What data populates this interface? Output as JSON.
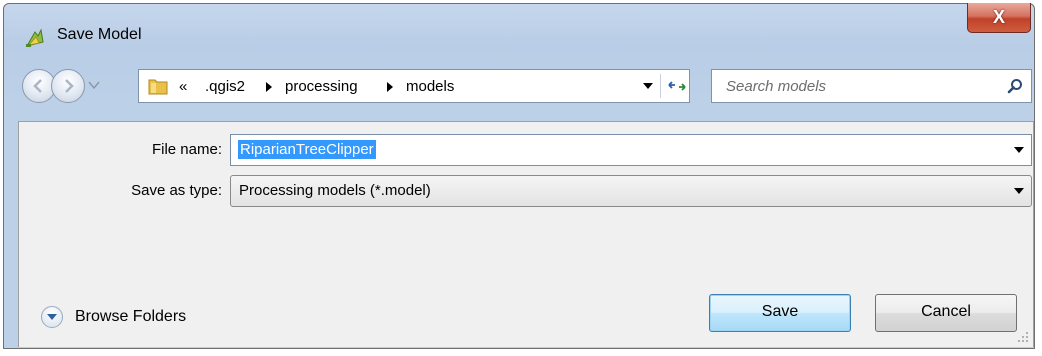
{
  "window": {
    "title": "Save Model",
    "close_label": "X"
  },
  "nav": {
    "breadcrumb_overflow": "«",
    "breadcrumbs": [
      ".qgis2",
      "processing",
      "models"
    ],
    "search_placeholder": "Search models"
  },
  "form": {
    "file_name_label": "File name:",
    "file_name_value": "RiparianTreeClipper",
    "save_type_label": "Save as type:",
    "save_type_value": "Processing models (*.model)"
  },
  "footer": {
    "browse_label": "Browse Folders",
    "save_label": "Save",
    "cancel_label": "Cancel"
  },
  "colors": {
    "selection": "#3399ff",
    "close_button": "#c1412a",
    "frame": "#b9cde6"
  }
}
